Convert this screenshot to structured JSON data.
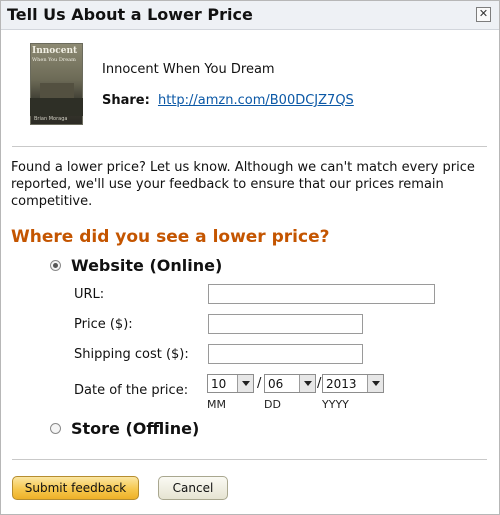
{
  "dialog": {
    "title": "Tell Us About a Lower Price",
    "close_icon": "close-icon"
  },
  "product": {
    "title": "Innocent When You Dream",
    "share_label": "Share:",
    "share_link": "http://amzn.com/B00DCJZ7QS",
    "cover": {
      "title": "Innocent",
      "subtitle": "When You Dream",
      "author": "Brian Moraga"
    }
  },
  "intro_text": "Found a lower price? Let us know. Although we can't match every price reported, we'll use your feedback to ensure that our prices remain competitive.",
  "question": "Where did you see a lower price?",
  "options": {
    "website": {
      "label": "Website (Online)",
      "selected": true
    },
    "store": {
      "label": "Store (Offline)",
      "selected": false
    }
  },
  "fields": {
    "url_label": "URL:",
    "url_value": "",
    "price_label": "Price ($):",
    "price_value": "",
    "shipping_label": "Shipping cost ($):",
    "shipping_value": "",
    "date_label": "Date of the price:"
  },
  "date": {
    "month": "10",
    "day": "06",
    "year": "2013",
    "separator": "/",
    "month_caption": "MM",
    "day_caption": "DD",
    "year_caption": "YYYY"
  },
  "buttons": {
    "submit_label": "Submit feedback",
    "cancel_label": "Cancel"
  },
  "colors": {
    "heading_accent": "#c45500",
    "link": "#0b58a6",
    "primary_button": "#f6c74e"
  }
}
